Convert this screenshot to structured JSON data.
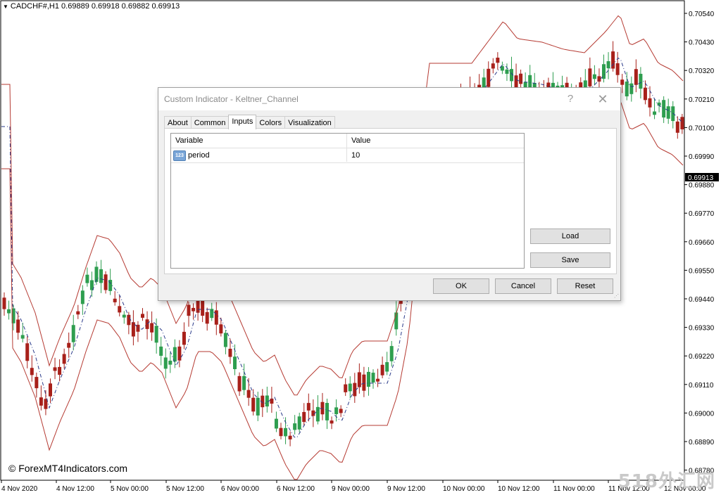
{
  "chart": {
    "symbol_line": "CADCHF#,H1  0.69889 0.69918 0.69882 0.69913",
    "price_labels": [
      "0.70540",
      "0.70430",
      "0.70320",
      "0.70210",
      "0.70100",
      "0.69990",
      "0.69880",
      "0.69770",
      "0.69660",
      "0.69550",
      "0.69440",
      "0.69330",
      "0.69220",
      "0.69110",
      "0.69000",
      "0.68890",
      "0.68780"
    ],
    "current_price": "0.69913",
    "time_labels": [
      "4 Nov 2020",
      "4 Nov 12:00",
      "5 Nov 00:00",
      "5 Nov 12:00",
      "6 Nov 00:00",
      "6 Nov 12:00",
      "9 Nov 00:00",
      "9 Nov 12:00",
      "10 Nov 00:00",
      "10 Nov 12:00",
      "11 Nov 00:00",
      "11 Nov 12:00",
      "12 Nov 00:00"
    ],
    "copyright": "© ForexMT4Indicators.com",
    "watermark": "518外汇网",
    "colors": {
      "bull": "#2e9e4f",
      "bear": "#a8201a",
      "channel": "#b53a32",
      "midline": "#2a3a8a",
      "current_price_bg": "#000000"
    }
  },
  "dialog": {
    "title": "Custom Indicator - Keltner_Channel",
    "help_icon": "?",
    "close_icon": "✕",
    "tabs": [
      "About",
      "Common",
      "Inputs",
      "Colors",
      "Visualization"
    ],
    "active_tab": "Inputs",
    "table": {
      "headers": [
        "Variable",
        "Value"
      ],
      "rows": [
        {
          "icon_text": "123",
          "variable": "period",
          "value": "10"
        }
      ]
    },
    "buttons": {
      "load": "Load",
      "save": "Save",
      "ok": "OK",
      "cancel": "Cancel",
      "reset": "Reset"
    }
  }
}
